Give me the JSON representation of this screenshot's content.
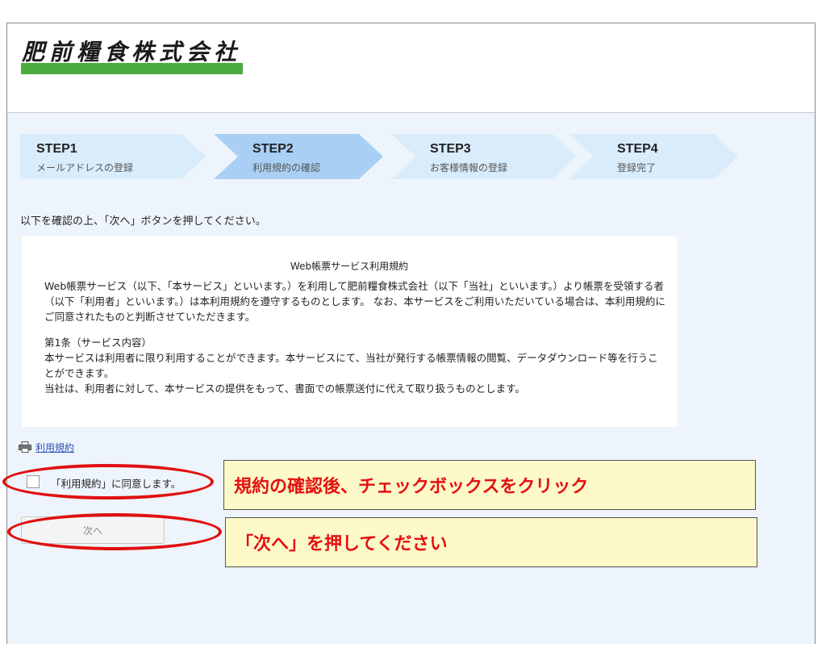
{
  "header": {
    "company_name": "肥前糧食株式会社"
  },
  "steps": [
    {
      "num": "STEP1",
      "label": "メールアドレスの登録"
    },
    {
      "num": "STEP2",
      "label": "利用規約の確認"
    },
    {
      "num": "STEP3",
      "label": "お客様情報の登録"
    },
    {
      "num": "STEP4",
      "label": "登録完了"
    }
  ],
  "colors": {
    "step_active": "#a9cff4",
    "step_inactive": "#d9ecfc",
    "logo_bar": "#4cac3f",
    "annotation_red": "#e01010"
  },
  "instruction": "以下を確認の上、「次へ」ボタンを押してください。",
  "terms": {
    "title": "Web帳票サービス利用規約",
    "paragraphs": [
      "Web帳票サービス（以下、「本サービス」といいます。）を利用して肥前糧食株式会社（以下「当社」といいます。）より帳票を受領する者（以下「利用者」といいます。）は本利用規約を遵守するものとします。 なお、本サービスをご利用いただいている場合は、本利用規約にご同意されたものと判断させていただきます。",
      "第1条（サービス内容）",
      "本サービスは利用者に限り利用することができます。本サービスにて、当社が発行する帳票情報の閲覧、データダウンロード等を行うことができます。",
      "当社は、利用者に対して、本サービスの提供をもって、書面での帳票送付に代えて取り扱うものとします。"
    ]
  },
  "print_link": {
    "icon": "printer-icon",
    "label": "利用規約"
  },
  "agree": {
    "label": "「利用規約」に同意します。",
    "checked": false
  },
  "next_button": {
    "label": "次へ",
    "enabled": false
  },
  "callouts": {
    "checkbox_hint": "規約の確認後、チェックボックスをクリック",
    "next_hint": "「次へ」を押してください"
  }
}
